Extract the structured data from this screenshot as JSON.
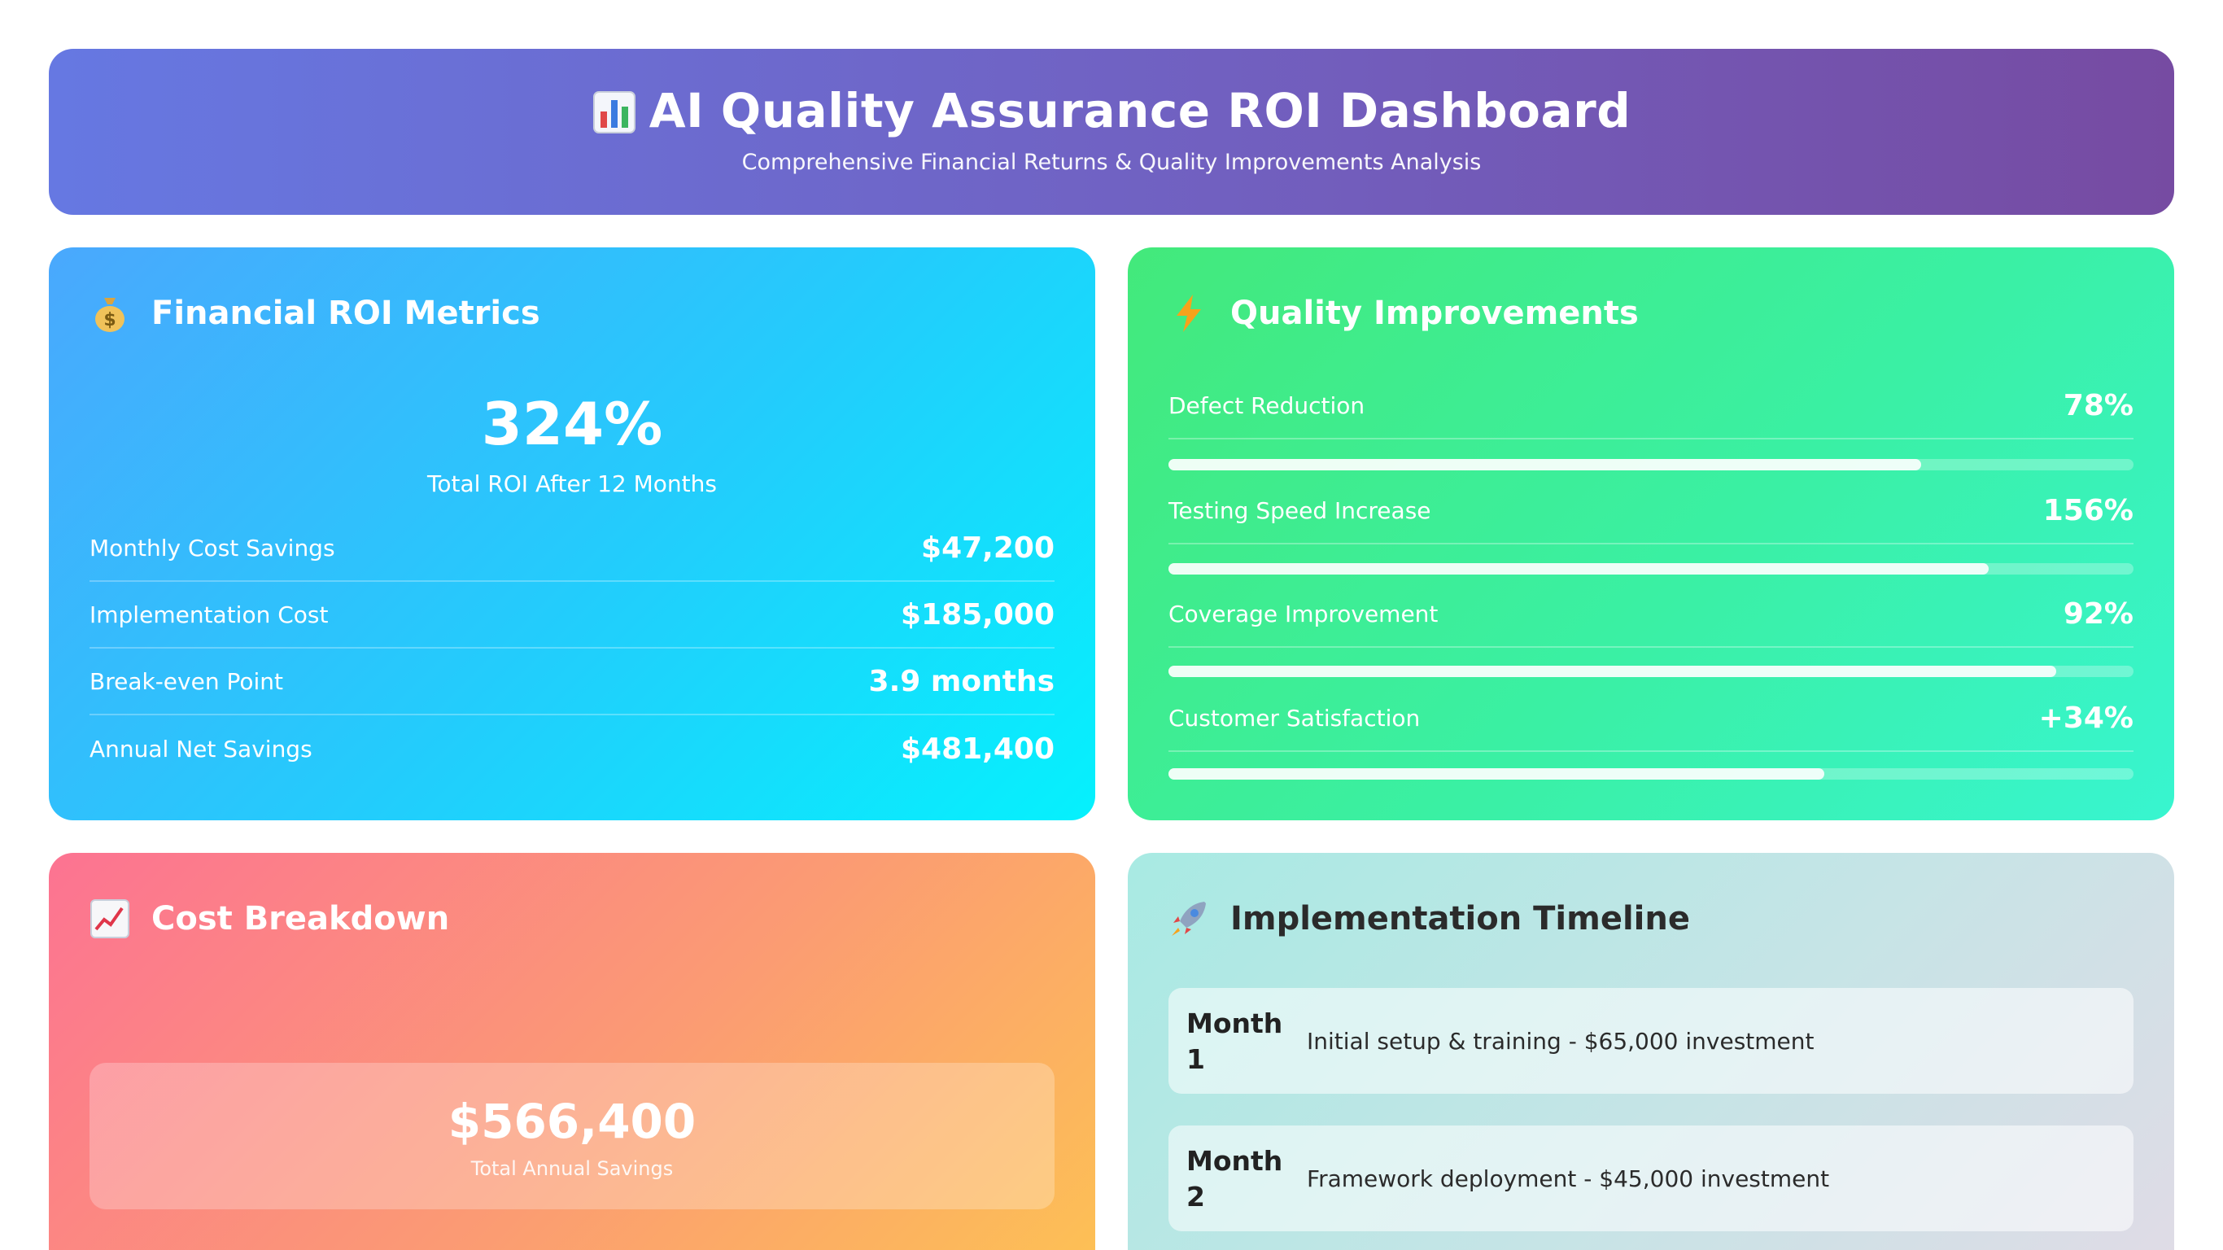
{
  "header": {
    "title": "AI Quality Assurance ROI Dashboard",
    "subtitle": "Comprehensive Financial Returns & Quality Improvements Analysis",
    "icon": "bar-chart-icon"
  },
  "financial": {
    "title": "Financial ROI Metrics",
    "icon": "money-bag-icon",
    "roi_value": "324%",
    "roi_label": "Total ROI After 12 Months",
    "metrics": [
      {
        "label": "Monthly Cost Savings",
        "value": "$47,200"
      },
      {
        "label": "Implementation Cost",
        "value": "$185,000"
      },
      {
        "label": "Break-even Point",
        "value": "3.9 months"
      },
      {
        "label": "Annual Net Savings",
        "value": "$481,400"
      }
    ]
  },
  "quality": {
    "title": "Quality Improvements",
    "icon": "lightning-icon",
    "items": [
      {
        "label": "Defect Reduction",
        "value": "78%",
        "progress": 0.78
      },
      {
        "label": "Testing Speed Increase",
        "value": "156%",
        "progress": 0.85
      },
      {
        "label": "Coverage Improvement",
        "value": "92%",
        "progress": 0.92
      },
      {
        "label": "Customer Satisfaction",
        "value": "+34%",
        "progress": 0.68
      }
    ]
  },
  "cost_breakdown": {
    "title": "Cost Breakdown",
    "icon": "trending-chart-icon",
    "total_amount": "$566,400",
    "total_label": "Total Annual Savings"
  },
  "timeline": {
    "title": "Implementation Timeline",
    "icon": "rocket-icon",
    "items": [
      {
        "month": "Month 1",
        "description": "Initial setup & training - $65,000 investment"
      },
      {
        "month": "Month 2",
        "description": "Framework deployment - $45,000 investment"
      }
    ]
  }
}
